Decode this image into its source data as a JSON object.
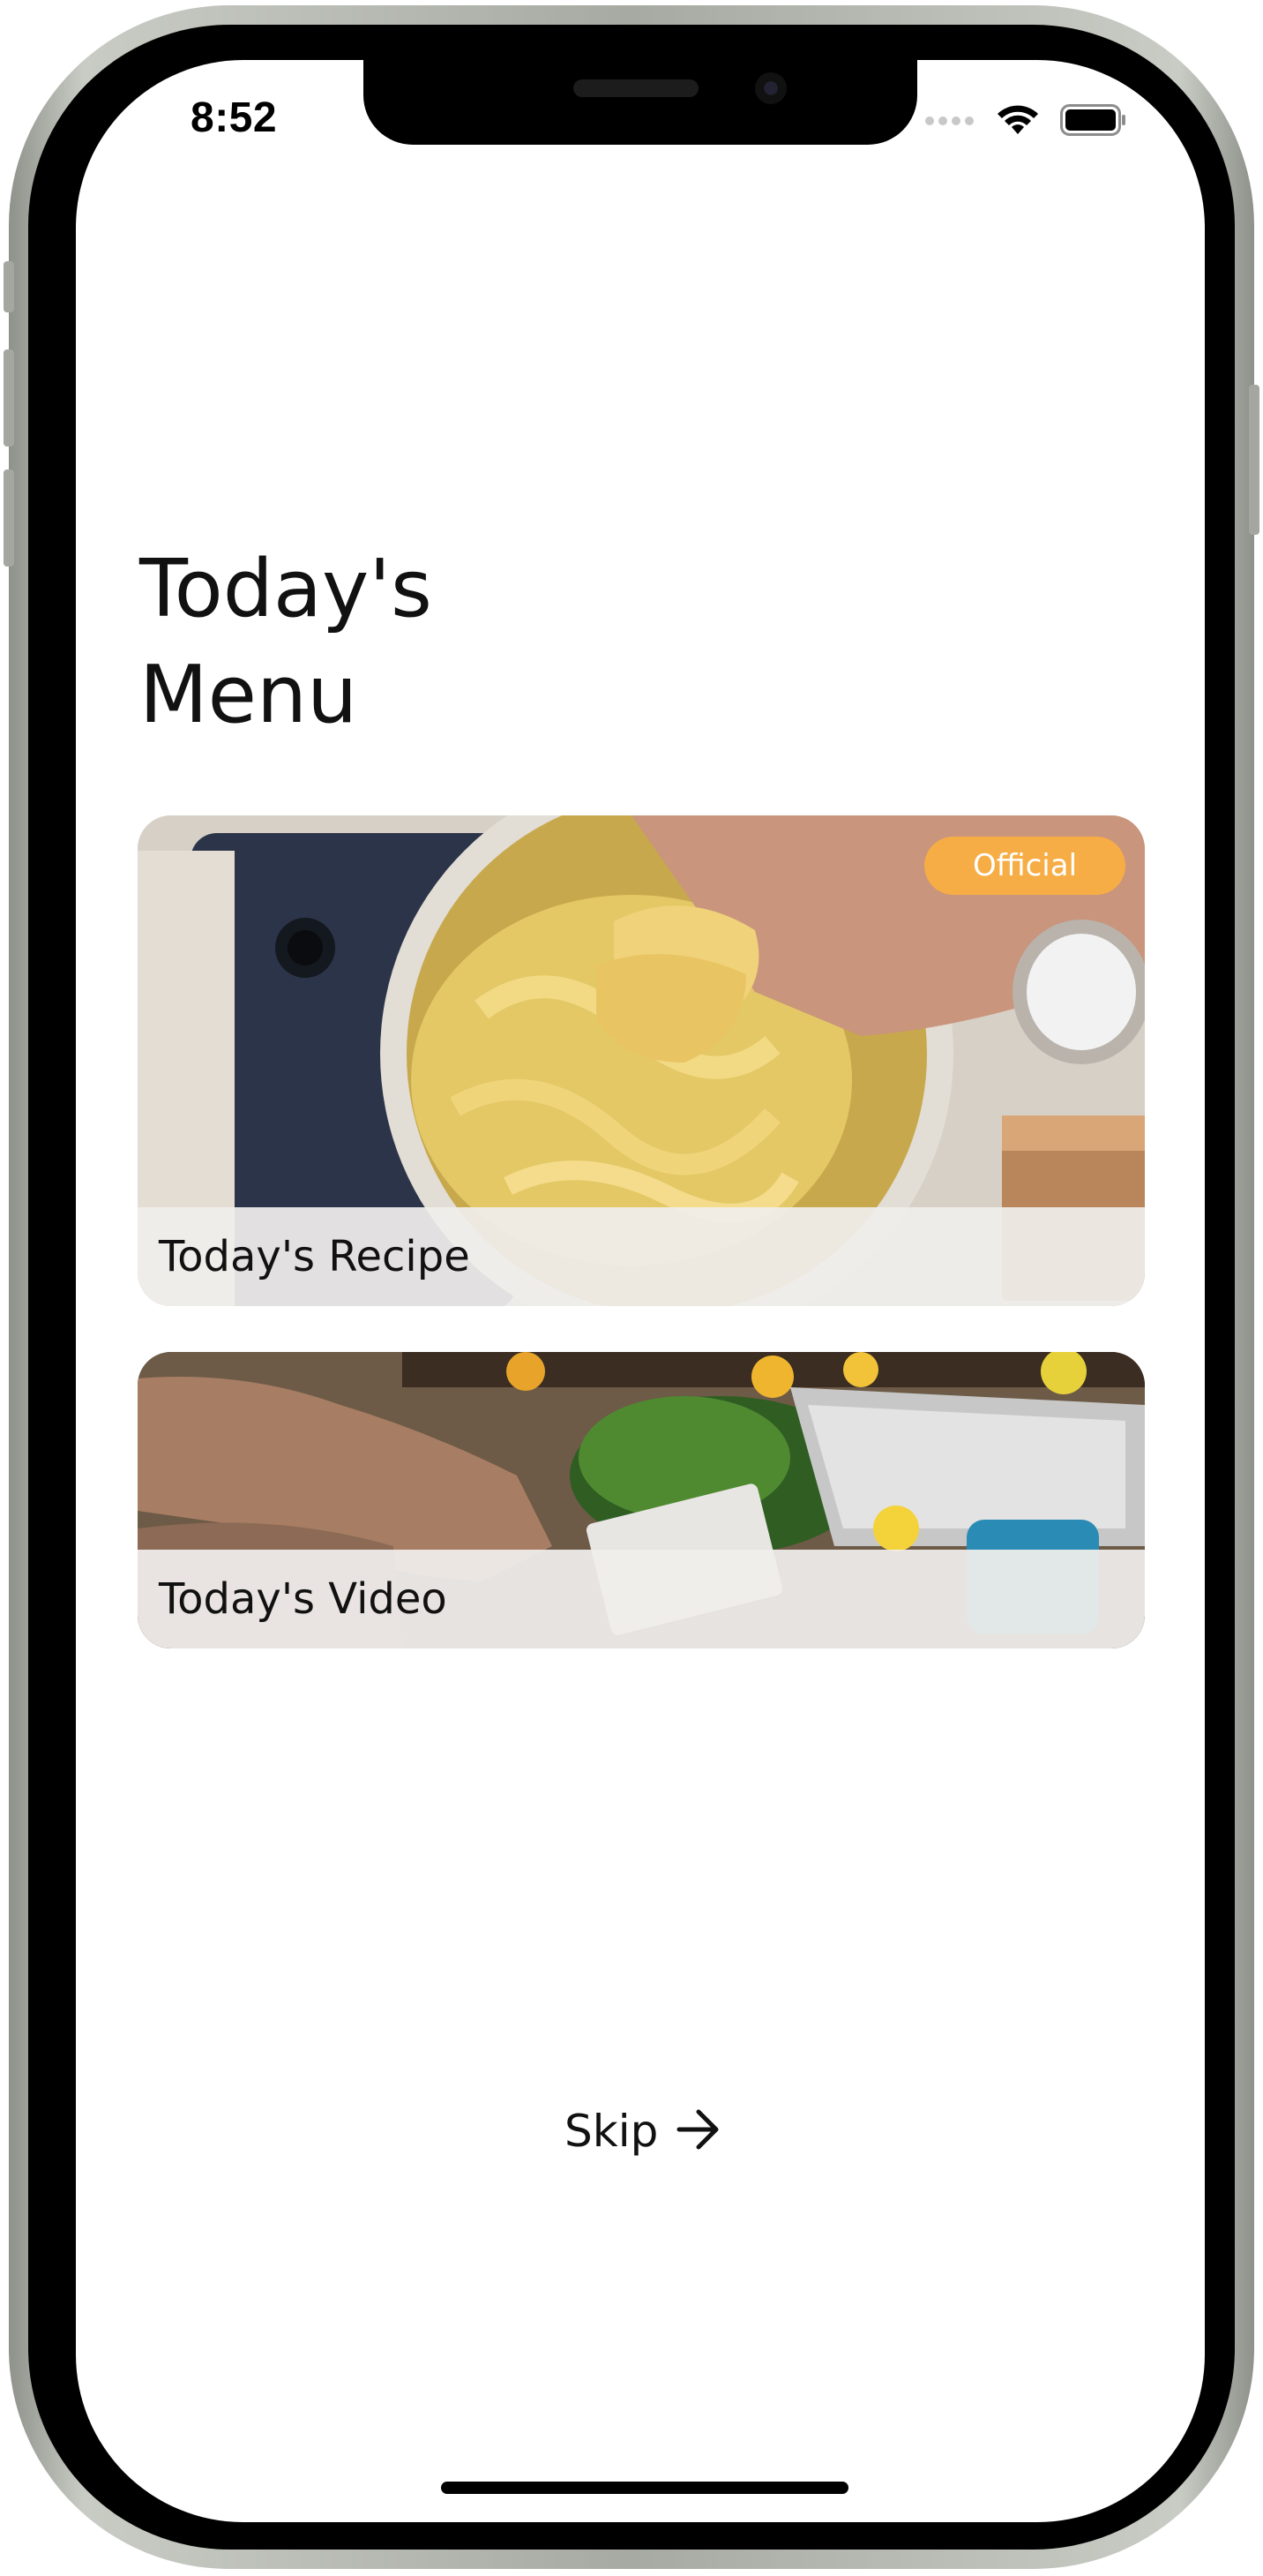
{
  "status_bar": {
    "time": "8:52",
    "icons": [
      "signal-dots-icon",
      "wifi-icon",
      "battery-icon"
    ]
  },
  "page": {
    "title_line1": "Today's",
    "title_line2": "Menu"
  },
  "cards": [
    {
      "label": "Today's Recipe",
      "badge": "Official",
      "badge_color": "#f7ad45"
    },
    {
      "label": "Today's Video"
    }
  ],
  "actions": {
    "skip_label": "Skip",
    "skip_icon": "arrow-right-icon"
  },
  "colors": {
    "accent": "#f7ad45",
    "text": "#111111",
    "background": "#ffffff"
  }
}
